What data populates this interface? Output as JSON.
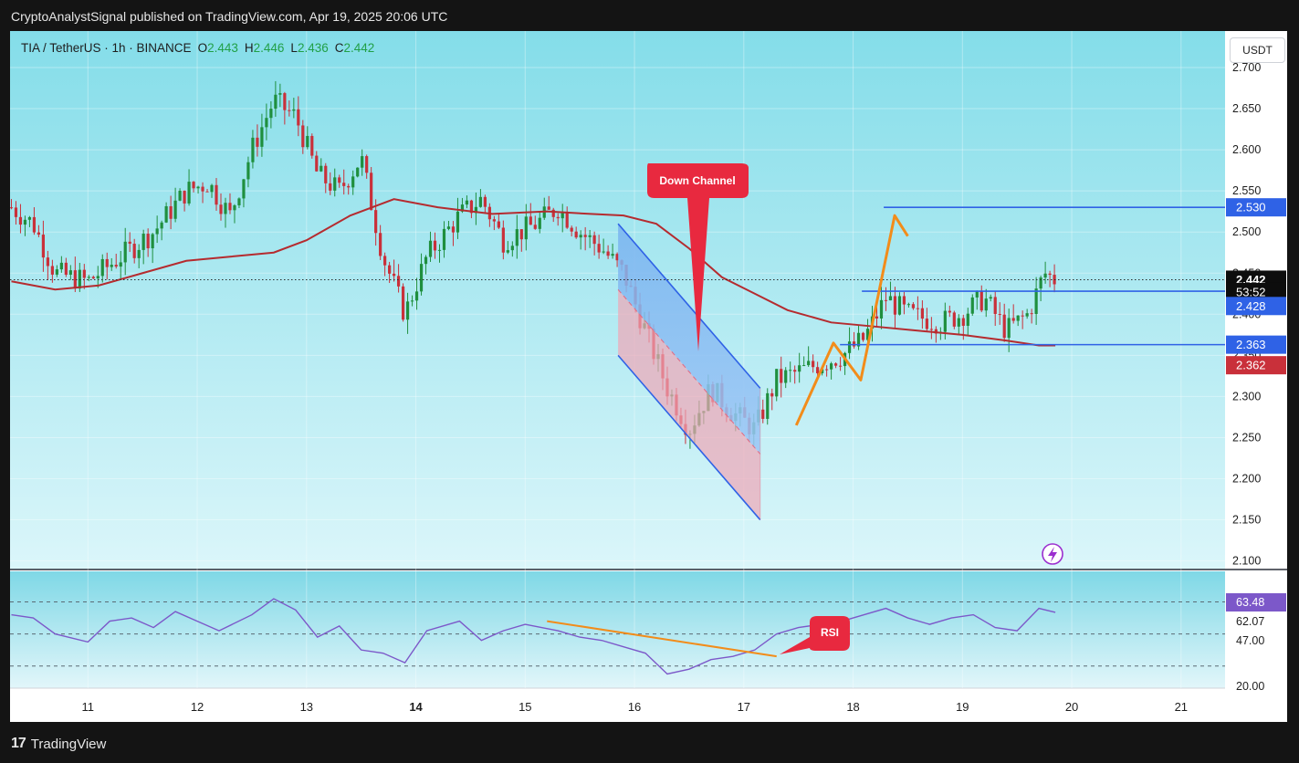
{
  "page": {
    "publisher_line": "CryptoAnalystSignal published on TradingView.com, Apr 19, 2025 20:06 UTC",
    "footer_brand": "TradingView",
    "footer_logo": "17"
  },
  "legend": {
    "pair": "TIA / TetherUS · 1h · BINANCE",
    "o_label": "O",
    "o_value": "2.443",
    "h_label": "H",
    "h_value": "2.446",
    "l_label": "L",
    "l_value": "2.436",
    "c_label": "C",
    "c_value": "2.442"
  },
  "currency_button": "USDT",
  "colors": {
    "background_top": "#84dde9",
    "background_bottom": "#dbf6fa",
    "candle_up": "#1f8f3e",
    "candle_down": "#c9303a",
    "moving_average": "#b52b2f",
    "level_lines": "#2f62e6",
    "orange_annotation": "#f28c1a",
    "callout": "#e8293f",
    "rsi_line": "#7c58c9"
  },
  "chart_data": [
    {
      "type": "candlestick",
      "symbol": "TIA / TetherUS",
      "interval": "1h",
      "exchange": "BINANCE",
      "ohlc": {
        "open": 2.443,
        "high": 2.446,
        "low": 2.436,
        "close": 2.442
      },
      "x_ticks": [
        "11",
        "12",
        "13",
        "14",
        "15",
        "16",
        "17",
        "18",
        "19",
        "20",
        "21"
      ],
      "y_ticks": [
        "2.100",
        "2.150",
        "2.200",
        "2.250",
        "2.300",
        "2.350",
        "2.400",
        "2.450",
        "2.500",
        "2.550",
        "2.600",
        "2.650",
        "2.700"
      ],
      "ylim": [
        2.085,
        2.71
      ],
      "price_path": [
        [
          10.3,
          2.53
        ],
        [
          10.5,
          2.51
        ],
        [
          10.7,
          2.45
        ],
        [
          11.0,
          2.44
        ],
        [
          11.3,
          2.47
        ],
        [
          11.6,
          2.5
        ],
        [
          11.9,
          2.55
        ],
        [
          12.1,
          2.56
        ],
        [
          12.3,
          2.52
        ],
        [
          12.5,
          2.6
        ],
        [
          12.7,
          2.66
        ],
        [
          12.9,
          2.64
        ],
        [
          13.1,
          2.57
        ],
        [
          13.3,
          2.55
        ],
        [
          13.5,
          2.59
        ],
        [
          13.7,
          2.47
        ],
        [
          13.9,
          2.4
        ],
        [
          14.1,
          2.47
        ],
        [
          14.4,
          2.52
        ],
        [
          14.6,
          2.54
        ],
        [
          14.8,
          2.49
        ],
        [
          15.1,
          2.51
        ],
        [
          15.3,
          2.53
        ],
        [
          15.5,
          2.5
        ],
        [
          15.7,
          2.48
        ],
        [
          15.9,
          2.45
        ],
        [
          16.1,
          2.38
        ],
        [
          16.3,
          2.31
        ],
        [
          16.5,
          2.26
        ],
        [
          16.7,
          2.31
        ],
        [
          16.9,
          2.28
        ],
        [
          17.1,
          2.26
        ],
        [
          17.3,
          2.32
        ],
        [
          17.5,
          2.33
        ],
        [
          17.7,
          2.34
        ],
        [
          17.9,
          2.35
        ],
        [
          18.1,
          2.37
        ],
        [
          18.3,
          2.42
        ],
        [
          18.5,
          2.4
        ],
        [
          18.8,
          2.39
        ],
        [
          19.0,
          2.4
        ],
        [
          19.2,
          2.42
        ],
        [
          19.4,
          2.38
        ],
        [
          19.6,
          2.4
        ],
        [
          19.75,
          2.45
        ],
        [
          19.85,
          2.442
        ]
      ],
      "moving_average": [
        [
          10.3,
          2.44
        ],
        [
          10.7,
          2.43
        ],
        [
          11.1,
          2.435
        ],
        [
          11.5,
          2.45
        ],
        [
          11.9,
          2.465
        ],
        [
          12.3,
          2.47
        ],
        [
          12.7,
          2.475
        ],
        [
          13.0,
          2.49
        ],
        [
          13.4,
          2.52
        ],
        [
          13.8,
          2.54
        ],
        [
          14.2,
          2.53
        ],
        [
          14.7,
          2.522
        ],
        [
          15.2,
          2.525
        ],
        [
          15.6,
          2.522
        ],
        [
          15.9,
          2.52
        ],
        [
          16.2,
          2.51
        ],
        [
          16.5,
          2.48
        ],
        [
          16.8,
          2.445
        ],
        [
          17.1,
          2.425
        ],
        [
          17.4,
          2.405
        ],
        [
          17.8,
          2.39
        ],
        [
          18.2,
          2.385
        ],
        [
          18.6,
          2.38
        ],
        [
          19.0,
          2.375
        ],
        [
          19.4,
          2.368
        ],
        [
          19.7,
          2.362
        ],
        [
          19.85,
          2.362
        ]
      ],
      "horizontal_levels": [
        2.53,
        2.428,
        2.363
      ],
      "down_channel": {
        "upper": [
          [
            15.85,
            2.51
          ],
          [
            17.15,
            2.31
          ]
        ],
        "lower": [
          [
            15.85,
            2.35
          ],
          [
            17.15,
            2.15
          ]
        ],
        "upper_label_anchor": [
          16.6,
          2.45
        ],
        "lower_label_anchor": [
          16.6,
          2.28
        ]
      },
      "orange_projection": [
        [
          17.48,
          2.265
        ],
        [
          17.82,
          2.365
        ],
        [
          18.07,
          2.32
        ],
        [
          18.38,
          2.52
        ],
        [
          18.5,
          2.495
        ]
      ],
      "price_labels": [
        {
          "text": "2.530",
          "value": 2.53,
          "color": "#2f62e6"
        },
        {
          "text": "2.442",
          "value": 2.442,
          "color": "#0d0d0d"
        },
        {
          "text": "53:52",
          "value": 2.427,
          "color": "#0d0d0d"
        },
        {
          "text": "2.428",
          "value": 2.41,
          "color": "#2f62e6"
        },
        {
          "text": "2.363",
          "value": 2.363,
          "color": "#2f62e6"
        },
        {
          "text": "2.362",
          "value": 2.338,
          "color": "#c9303a"
        }
      ],
      "annotations": [
        "Down Channel"
      ]
    },
    {
      "type": "line",
      "indicator": "RSI",
      "y_ticks": [
        "20.00",
        "47.00",
        "62.07",
        "63.48"
      ],
      "levels": [
        70,
        50,
        30
      ],
      "ylim": [
        15,
        80
      ],
      "values": [
        [
          10.3,
          62
        ],
        [
          10.5,
          60
        ],
        [
          10.7,
          50
        ],
        [
          11.0,
          45
        ],
        [
          11.2,
          58
        ],
        [
          11.4,
          60
        ],
        [
          11.6,
          54
        ],
        [
          11.8,
          64
        ],
        [
          12.0,
          58
        ],
        [
          12.2,
          52
        ],
        [
          12.5,
          62
        ],
        [
          12.7,
          72
        ],
        [
          12.9,
          65
        ],
        [
          13.1,
          48
        ],
        [
          13.3,
          55
        ],
        [
          13.5,
          40
        ],
        [
          13.7,
          38
        ],
        [
          13.9,
          32
        ],
        [
          14.1,
          52
        ],
        [
          14.4,
          58
        ],
        [
          14.6,
          46
        ],
        [
          14.8,
          52
        ],
        [
          15.0,
          56
        ],
        [
          15.3,
          52
        ],
        [
          15.5,
          48
        ],
        [
          15.7,
          46
        ],
        [
          15.9,
          42
        ],
        [
          16.1,
          38
        ],
        [
          16.3,
          25
        ],
        [
          16.5,
          28
        ],
        [
          16.7,
          34
        ],
        [
          16.9,
          36
        ],
        [
          17.1,
          40
        ],
        [
          17.3,
          50
        ],
        [
          17.5,
          54
        ],
        [
          17.7,
          56
        ],
        [
          17.9,
          58
        ],
        [
          18.1,
          62
        ],
        [
          18.3,
          66
        ],
        [
          18.5,
          60
        ],
        [
          18.7,
          56
        ],
        [
          18.9,
          60
        ],
        [
          19.1,
          62
        ],
        [
          19.3,
          54
        ],
        [
          19.5,
          52
        ],
        [
          19.7,
          66
        ],
        [
          19.85,
          63.48
        ]
      ],
      "trendline": [
        [
          15.2,
          58
        ],
        [
          17.3,
          36
        ]
      ],
      "annotations": [
        "RSI"
      ]
    }
  ]
}
